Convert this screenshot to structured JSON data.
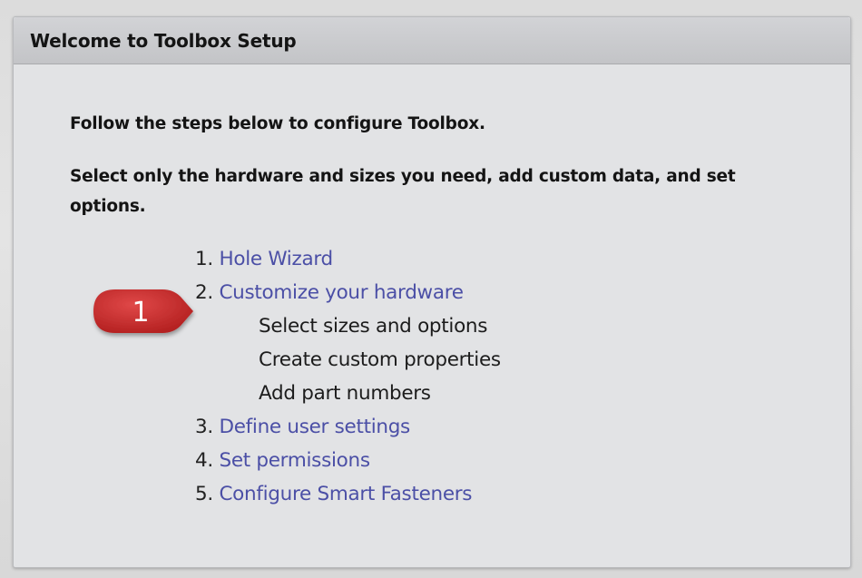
{
  "dialog": {
    "title": "Welcome to Toolbox Setup"
  },
  "intro": {
    "line1": "Follow the steps below to configure Toolbox.",
    "line2": "Select only the hardware and sizes you need, add custom data, and set options."
  },
  "callout": {
    "number": "1",
    "color": "#c42b2b"
  },
  "steps": [
    {
      "number": "1.",
      "label": "Hole Wizard"
    },
    {
      "number": "2.",
      "label": "Customize your hardware"
    },
    {
      "number": "3.",
      "label": "Define user settings"
    },
    {
      "number": "4.",
      "label": "Set permissions"
    },
    {
      "number": "5.",
      "label": "Configure Smart Fasteners"
    }
  ],
  "substeps": [
    "Select sizes and options",
    "Create custom properties",
    "Add part numbers"
  ],
  "colors": {
    "link": "#4b4fa6",
    "header_bg": "#c8c9cc",
    "panel_bg": "#e2e3e5"
  }
}
